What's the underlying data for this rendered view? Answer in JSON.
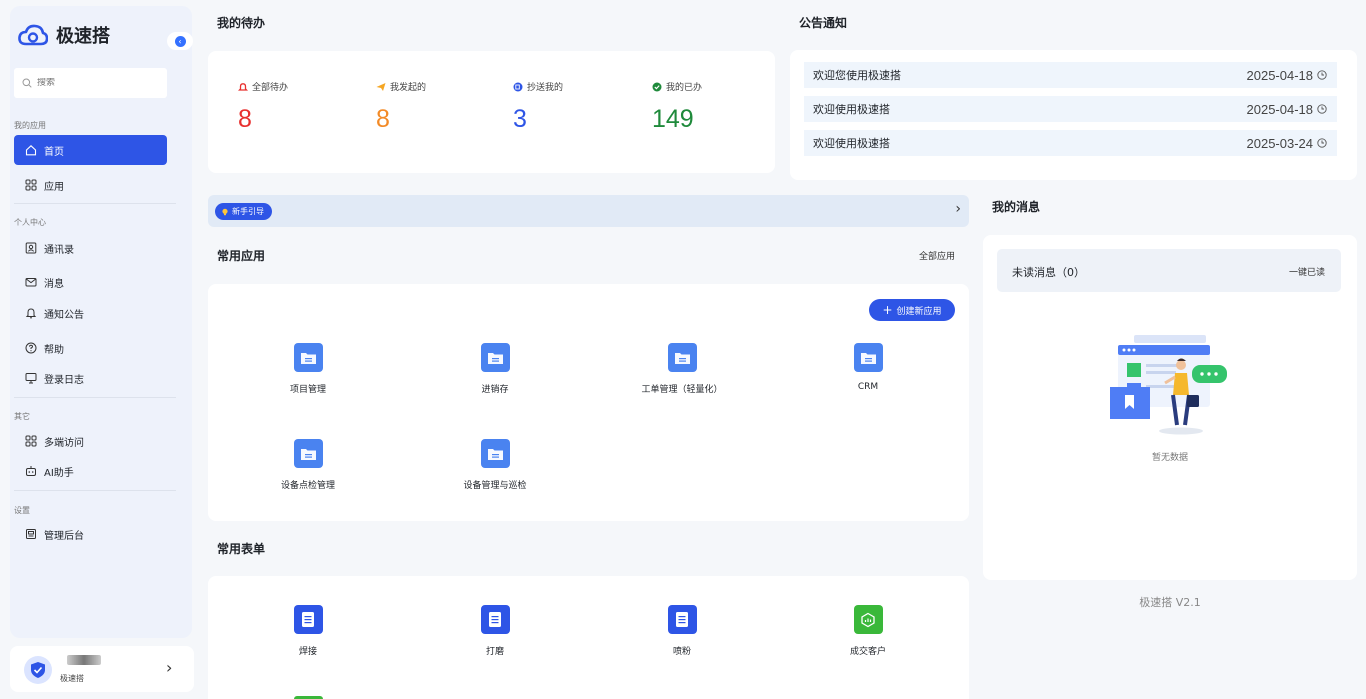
{
  "app": {
    "name": "极速搭",
    "version": "极速搭 V2.1"
  },
  "sidebar": {
    "search_placeholder": "搜索",
    "groups": [
      {
        "label": "我的应用",
        "items": [
          {
            "label": "首页",
            "icon": "home-icon",
            "active": true
          },
          {
            "label": "应用",
            "icon": "grid-icon"
          }
        ]
      },
      {
        "label": "个人中心",
        "items": [
          {
            "label": "通讯录",
            "icon": "contacts-icon"
          },
          {
            "label": "消息",
            "icon": "mail-icon"
          },
          {
            "label": "通知公告",
            "icon": "bell-icon"
          },
          {
            "label": "帮助",
            "icon": "help-icon"
          },
          {
            "label": "登录日志",
            "icon": "monitor-icon"
          }
        ]
      },
      {
        "label": "其它",
        "items": [
          {
            "label": "多端访问",
            "icon": "grid-icon"
          },
          {
            "label": "AI助手",
            "icon": "ai-icon"
          }
        ]
      },
      {
        "label": "设置",
        "items": [
          {
            "label": "管理后台",
            "icon": "admin-icon"
          }
        ]
      }
    ],
    "user": {
      "org": "极速搭"
    }
  },
  "todo": {
    "title": "我的待办",
    "items": [
      {
        "label": "全部待办",
        "count": "8",
        "color": "#e8302f",
        "icon": "bell-icon"
      },
      {
        "label": "我发起的",
        "count": "8",
        "color": "#f38a26",
        "icon": "send-icon"
      },
      {
        "label": "抄送我的",
        "count": "3",
        "color": "#2e55e6",
        "icon": "copy-icon"
      },
      {
        "label": "我的已办",
        "count": "149",
        "color": "#1f8a3b",
        "icon": "check-icon"
      }
    ]
  },
  "notices": {
    "title": "公告通知",
    "items": [
      {
        "text": "欢迎您使用极速搭",
        "date": "2025-04-18"
      },
      {
        "text": "欢迎使用极速搭",
        "date": "2025-04-18"
      },
      {
        "text": "欢迎使用极速搭",
        "date": "2025-03-24"
      }
    ]
  },
  "guide": {
    "label": "新手引导"
  },
  "common_apps": {
    "title": "常用应用",
    "all_link": "全部应用",
    "create_label": "创建新应用",
    "items": [
      {
        "name": "项目管理"
      },
      {
        "name": "进销存"
      },
      {
        "name": "工单管理（轻量化）"
      },
      {
        "name": "CRM"
      },
      {
        "name": "设备点检管理"
      },
      {
        "name": "设备管理与巡检"
      }
    ]
  },
  "common_forms": {
    "title": "常用表单",
    "items": [
      {
        "name": "焊接",
        "color": "#2e55e6"
      },
      {
        "name": "打磨",
        "color": "#2e55e6"
      },
      {
        "name": "喷粉",
        "color": "#2e55e6"
      },
      {
        "name": "成交客户",
        "color": "#3ab83a"
      }
    ]
  },
  "messages": {
    "title": "我的消息",
    "unread_label": "未读消息（0）",
    "read_all": "一键已读",
    "empty": "暂无数据"
  },
  "colors": {
    "primary": "#2e55e6",
    "app_icon": "#4a83f0"
  }
}
